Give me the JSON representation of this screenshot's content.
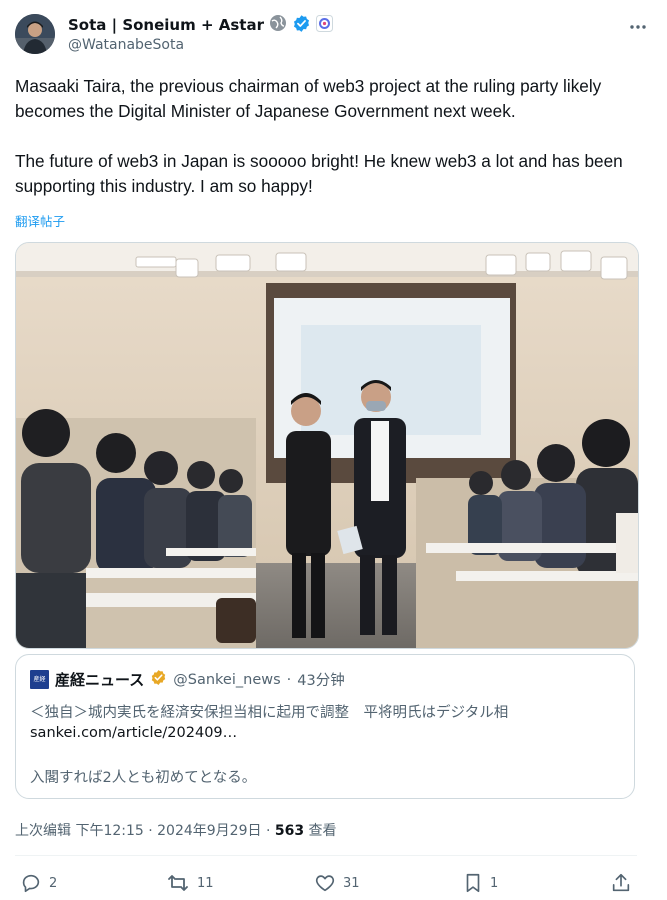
{
  "author": {
    "display_name": "Sota | Soneium + Astar",
    "handle": "@WatanabeSota"
  },
  "more_icon": "more-icon",
  "tweet": {
    "text": "Masaaki Taira, the previous chairman of web3 project at the ruling party likely becomes the Digital Minister of Japanese Government next week.\n\nThe future of web3 in Japan is sooooo bright! He knew web3 a lot and has been supporting this industry. I am so happy!",
    "translate_label": "翻译帖子"
  },
  "quote": {
    "logo_text": "産経",
    "name": "産経ニュース",
    "handle": "@Sankei_news",
    "separator": "·",
    "time": "43分钟",
    "headline": "＜独自＞城内実氏を経済安保担当相に起用で調整　平将明氏はデジタル相",
    "link": "sankei.com/article/202409…",
    "body": "入閣すれば2人とも初めてとなる。"
  },
  "meta": {
    "edited": "上次编辑 下午12:15 · 2024年9月29日 ·",
    "views_count": "563",
    "views_label": "查看"
  },
  "actions": {
    "replies": "2",
    "reposts": "11",
    "likes": "31",
    "bookmarks": "1"
  },
  "colors": {
    "accent": "#1d9bf0",
    "verified_gold": "#e8a826",
    "muted": "#536471"
  }
}
